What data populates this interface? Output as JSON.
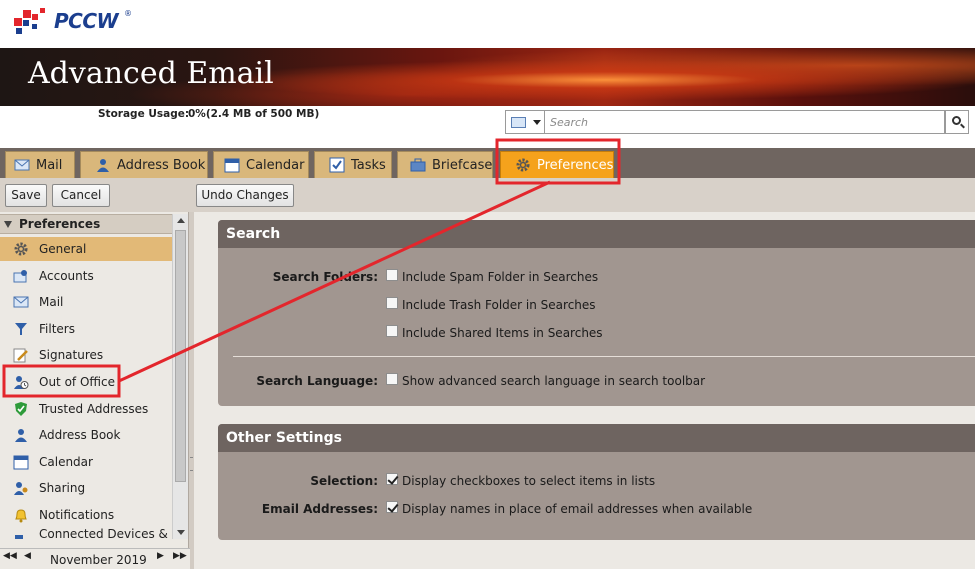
{
  "logo": {
    "text": "PCCW",
    "reg": "®"
  },
  "banner": {
    "title": "Advanced Email"
  },
  "storage": {
    "label": "Storage Usage:",
    "value": "0%(2.4 MB of 500 MB)"
  },
  "search": {
    "placeholder": "Search"
  },
  "tabs": [
    {
      "label": "Mail",
      "icon": "mail-icon"
    },
    {
      "label": "Address Book",
      "icon": "address-book-icon"
    },
    {
      "label": "Calendar",
      "icon": "calendar-icon"
    },
    {
      "label": "Tasks",
      "icon": "tasks-icon"
    },
    {
      "label": "Briefcase",
      "icon": "briefcase-icon"
    },
    {
      "label": "Preferences",
      "icon": "gear-icon",
      "active": true
    }
  ],
  "toolbar": {
    "save_label": "Save",
    "cancel_label": "Cancel",
    "undo_label": "Undo Changes"
  },
  "sidebar": {
    "header": "Preferences",
    "items": [
      {
        "label": "General",
        "icon": "gear-icon",
        "selected": true
      },
      {
        "label": "Accounts",
        "icon": "accounts-icon"
      },
      {
        "label": "Mail",
        "icon": "mail-icon"
      },
      {
        "label": "Filters",
        "icon": "filter-icon"
      },
      {
        "label": "Signatures",
        "icon": "signature-icon"
      },
      {
        "label": "Out of Office",
        "icon": "out-of-office-icon"
      },
      {
        "label": "Trusted Addresses",
        "icon": "shield-icon"
      },
      {
        "label": "Address Book",
        "icon": "address-book-icon"
      },
      {
        "label": "Calendar",
        "icon": "calendar-icon"
      },
      {
        "label": "Sharing",
        "icon": "sharing-icon"
      },
      {
        "label": "Notifications",
        "icon": "bell-icon"
      },
      {
        "label": "Connected Devices & Ap",
        "icon": "devices-icon"
      }
    ]
  },
  "calendar_nav": {
    "month": "November 2019"
  },
  "search_panel": {
    "title": "Search",
    "folders_label": "Search Folders:",
    "options": [
      {
        "label": "Include Spam Folder in Searches",
        "checked": false
      },
      {
        "label": "Include Trash Folder in Searches",
        "checked": false
      },
      {
        "label": "Include Shared Items in Searches",
        "checked": false
      }
    ],
    "language_label": "Search Language:",
    "language_option": {
      "label": "Show advanced search language in search toolbar",
      "checked": false
    }
  },
  "other_panel": {
    "title": "Other Settings",
    "selection_label": "Selection:",
    "selection_option": {
      "label": "Display checkboxes to select items in lists",
      "checked": true
    },
    "email_label": "Email Addresses:",
    "email_option": {
      "label": "Display names in place of email addresses when available",
      "checked": true
    }
  },
  "colors": {
    "active_tab": "#f5a21c",
    "tab": "#d9b77b",
    "panel_title": "#6e6460",
    "panel_body": "#a19690",
    "annotation": "#e3262c"
  }
}
